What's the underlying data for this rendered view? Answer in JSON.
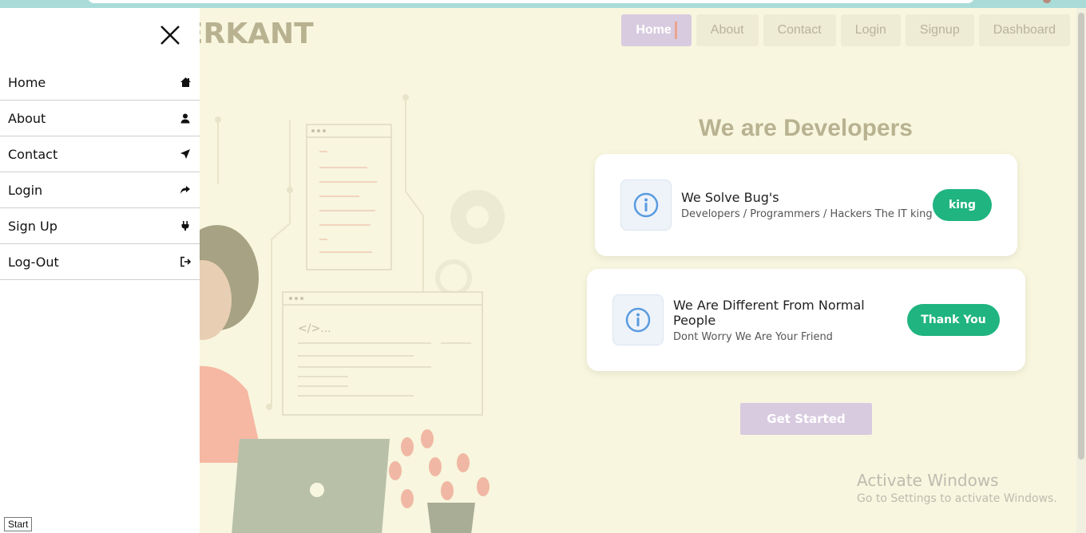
{
  "brand": {
    "text": "DERKANT"
  },
  "nav": {
    "items": [
      {
        "label": "Home"
      },
      {
        "label": "About"
      },
      {
        "label": "Contact"
      },
      {
        "label": "Login"
      },
      {
        "label": "Signup"
      },
      {
        "label": "Dashboard"
      }
    ]
  },
  "hero": {
    "title": "We are Developers",
    "cards": [
      {
        "title": "We Solve Bug's",
        "subtitle": "Developers / Programmers / Hackers The IT king",
        "button": "king"
      },
      {
        "title": "We Are Different From Normal People",
        "subtitle": "Dont Worry We Are Your Friend",
        "button": "Thank You"
      }
    ],
    "cta": "Get Started"
  },
  "illustration": {
    "code_tag": "</>..."
  },
  "sidebar": {
    "items": [
      {
        "label": "Home",
        "icon": "home-icon"
      },
      {
        "label": "About",
        "icon": "user-icon"
      },
      {
        "label": "Contact",
        "icon": "send-icon"
      },
      {
        "label": "Login",
        "icon": "share-arrow-icon"
      },
      {
        "label": "Sign Up",
        "icon": "plug-icon"
      },
      {
        "label": "Log-Out",
        "icon": "logout-icon"
      }
    ]
  },
  "watermark": {
    "line1": "Activate Windows",
    "line2": "Go to Settings to activate Windows."
  },
  "tooltip": {
    "text": "Start"
  },
  "colors": {
    "accent_green": "#1fb480",
    "nav_active": "#d8cbe0",
    "brand": "#b8b291",
    "info_blue": "#5a9be0"
  }
}
